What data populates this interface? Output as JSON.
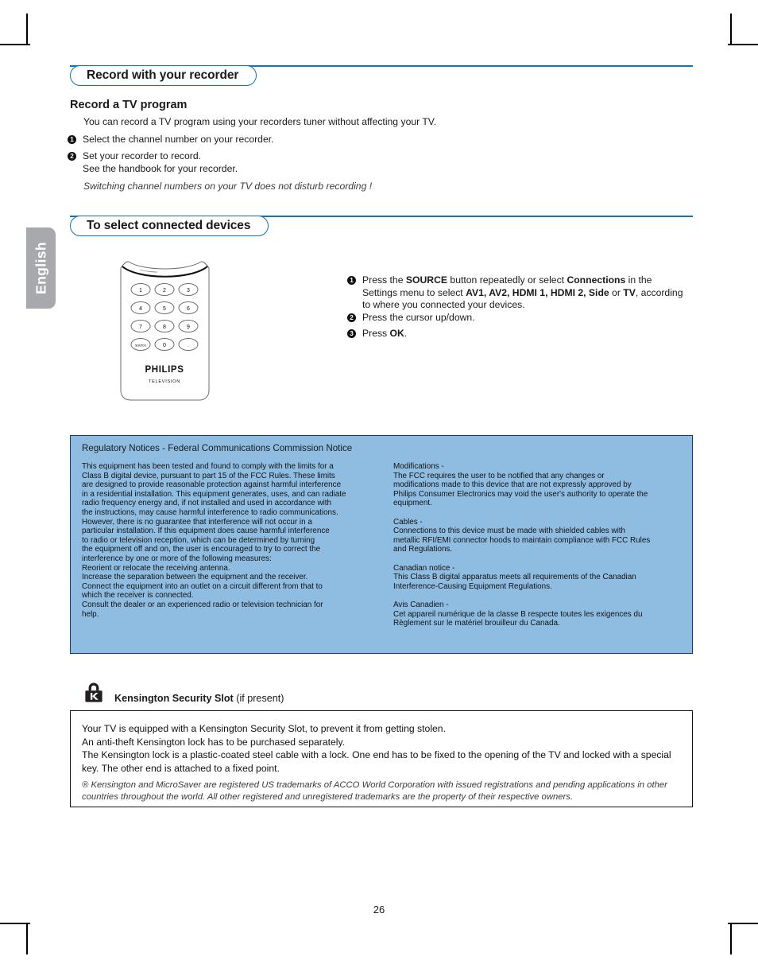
{
  "document": {
    "language_tab": "English",
    "page_number": "26"
  },
  "sections": {
    "record": {
      "header": "Record with your recorder",
      "subheading": "Record a TV program",
      "intro": "You can record a TV program using your recorders tuner without affecting your TV.",
      "steps": [
        {
          "number": "1",
          "text": "Select the channel number on your recorder."
        },
        {
          "number": "2",
          "text": "Set your recorder to record.\nSee the handbook for your recorder."
        }
      ],
      "note": "Switching channel numbers on your TV does not disturb recording !"
    },
    "connected_devices": {
      "header": "To select connected devices",
      "steps": [
        {
          "number": "1",
          "html": "Press the <b>SOURCE</b> button repeatedly or select <b>Connections</b> in the Settings menu to select <b>AV1, AV2, HDMI 1, HDMI 2, Side</b> or <b>TV</b>, according to where you connected your devices."
        },
        {
          "number": "2",
          "html": "Press the cursor up/down."
        },
        {
          "number": "3",
          "html": "Press <b>OK</b>."
        }
      ]
    }
  },
  "remote": {
    "brand": "PHILIPS",
    "sub_brand": "TELEVISION",
    "keys": [
      [
        "1",
        "2",
        "3"
      ],
      [
        "4",
        "5",
        "6"
      ],
      [
        "7",
        "8",
        "9"
      ],
      [
        "source",
        "0",
        "."
      ]
    ]
  },
  "fcc": {
    "title": "Regulatory Notices - Federal Communications Commission Notice",
    "left_column": [
      "This equipment has been tested and found to comply with the limits for a",
      "Class B digital device, pursuant to part 15 of the FCC Rules. These limits",
      "are designed to provide reasonable protection against harmful interference",
      "in a residential installation. This equipment generates, uses, and can radiate",
      "radio frequency energy and, if not installed and used in accordance with",
      "the instructions, may cause harmful interference to radio communications.",
      "However, there is no guarantee that interference will not occur in a",
      "particular installation. If this equipment does cause harmful interference",
      "to radio or television reception, which can be determined by turning",
      "the equipment off and on, the user is encouraged to try to correct the",
      "interference by one or more of the following measures:",
      "Reorient or relocate the receiving antenna.",
      "Increase the separation between the equipment and the receiver.",
      "Connect the equipment into an outlet on a circuit different from that to",
      "which the receiver is connected.",
      "Consult the dealer or an experienced radio or television technician for",
      "help."
    ],
    "right_column": [
      "Modifications -",
      "The FCC requires the user to be notified that any changes or",
      "modifications made to this device that are not expressly approved by",
      "Philips Consumer Electronics may void the user's authority to operate the",
      "equipment.",
      "",
      "Cables -",
      "Connections to this device must be made with shielded cables with",
      "metallic RFI/EMI connector hoods to maintain compliance with FCC Rules",
      "and Regulations.",
      "",
      "Canadian notice -",
      "This Class B digital apparatus meets all requirements of the Canadian",
      "Interference-Causing Equipment Regulations.",
      "",
      "Avis Canadien -",
      "Cet appareil numérique de la classe B respecte toutes les exigences du",
      "Règlement sur le matériel brouilleur du Canada."
    ]
  },
  "kensington": {
    "title_bold": "Kensington Security Slot",
    "title_light": " (if present)",
    "body_lines": [
      "Your TV is equipped with a Kensington Security Slot, to prevent it from getting stolen.",
      "An anti-theft Kensington lock has to be purchased separately.",
      "The Kensington lock is a plastic-coated steel cable with a lock. One end has to be fixed to the opening of the TV and locked with a special key. The other end is attached to a fixed point."
    ],
    "trademark": "® Kensington and MicroSaver are registered US trademarks of ACCO World Corporation with issued registrations and pending applications in other countries throughout the world. All other registered and unregistered trademarks are the property of their respective owners."
  },
  "colors": {
    "accent_blue": "#0f76bc",
    "notice_fill": "#8fbde2",
    "notice_border": "#1b3a6b",
    "tab_gray": "#a7a9ac"
  }
}
